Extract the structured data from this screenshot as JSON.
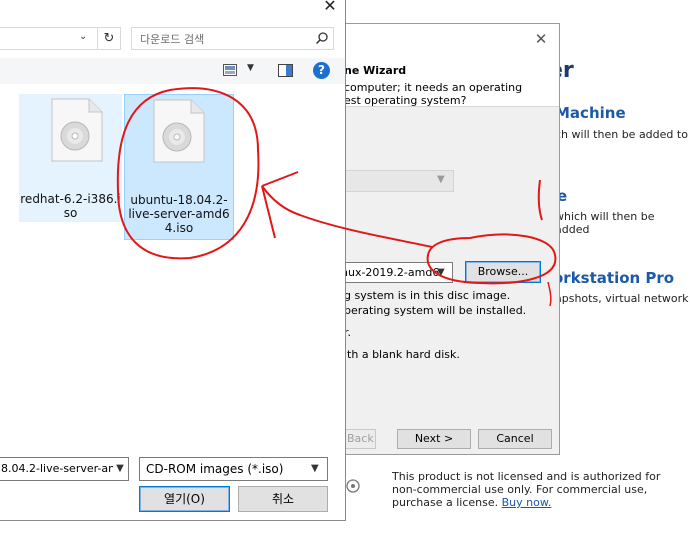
{
  "background_window": {
    "title_fragment": "er",
    "section1_heading": "Machine",
    "section1_text": "ch will then be added to",
    "section2_heading": "e",
    "section2_text": "which will then be added",
    "section3_heading": "orkstation Pro",
    "section3_text": "apshots, virtual network",
    "license_text": "This product is not licensed and is authorized for non-commercial use only. For commercial use, purchase a license.",
    "license_link": "Buy now."
  },
  "wizard": {
    "title": "ne Wizard",
    "desc_line1": "computer; it needs an operating",
    "desc_line2": "est operating system?",
    "iso_value": "nux-2019.2-amd6",
    "browse_label": "Browse...",
    "info_line1": "g system is in this disc image.",
    "info_line2": "perating system will be installed.",
    "option_later": "r.",
    "option_blank": "ith a blank hard disk.",
    "back_label": "Back",
    "next_label": "Next >",
    "cancel_label": "Cancel"
  },
  "file_dialog": {
    "search_placeholder": "다운로드 검색",
    "files": [
      {
        "name_line1": "redhat-6.2-i386.i",
        "name_line2": "so",
        "selected": false
      },
      {
        "name_line1": "ubuntu-18.04.2-",
        "name_line2": "live-server-amd6",
        "name_line3": "4.iso",
        "selected": true
      }
    ],
    "file_name_value": "8.04.2-live-server-an",
    "file_type_value": "CD-ROM images (*.iso)",
    "open_label": "열기(O)",
    "cancel_label": "취소"
  },
  "colors": {
    "selection_bg": "#cce8ff",
    "selection_border": "#99d1ff",
    "hover_bg": "#e5f3ff",
    "accent_blue": "#0078d7",
    "heading_blue": "#1c5aa6",
    "annotation_red": "#e01818"
  },
  "icons": [
    "close-icon",
    "chevron-down-icon",
    "refresh-icon",
    "search-icon",
    "view-icon",
    "preview-pane-icon",
    "help-icon",
    "disc-image-icon"
  ]
}
